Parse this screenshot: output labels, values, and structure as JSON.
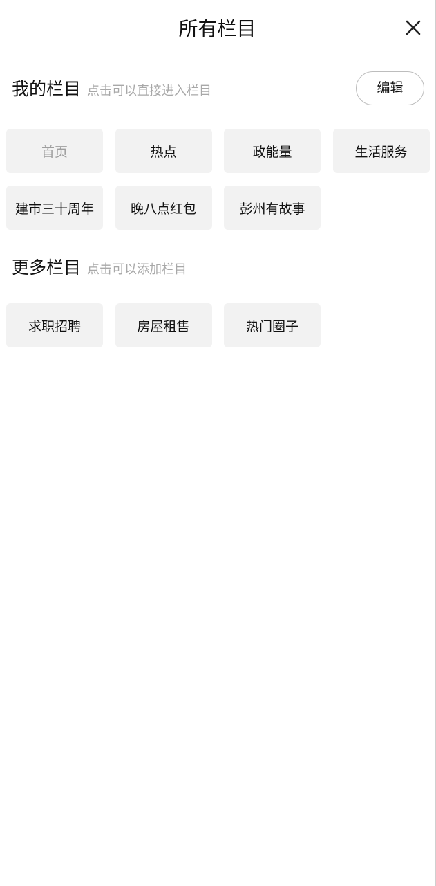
{
  "header": {
    "title": "所有栏目",
    "close_icon": "close-icon"
  },
  "my_columns": {
    "title": "我的栏目",
    "hint": "点击可以直接进入栏目",
    "edit_label": "编辑",
    "items": [
      {
        "label": "首页",
        "fixed": true
      },
      {
        "label": "热点",
        "fixed": false
      },
      {
        "label": "政能量",
        "fixed": false
      },
      {
        "label": "生活服务",
        "fixed": false
      },
      {
        "label": "建市三十周年",
        "fixed": false
      },
      {
        "label": "晚八点红包",
        "fixed": false
      },
      {
        "label": "彭州有故事",
        "fixed": false
      }
    ]
  },
  "more_columns": {
    "title": "更多栏目",
    "hint": "点击可以添加栏目",
    "items": [
      {
        "label": "求职招聘"
      },
      {
        "label": "房屋租售"
      },
      {
        "label": "热门圈子"
      }
    ]
  },
  "colors": {
    "chip_background": "#f2f2f2",
    "hint_text": "#a8a8a8",
    "fixed_chip_text": "#9e9e9e"
  }
}
